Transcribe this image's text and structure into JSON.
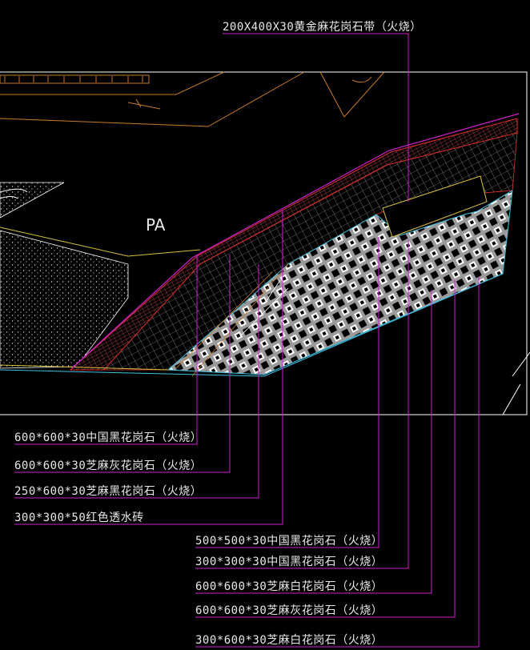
{
  "zone_label": "PA",
  "top_callout": "200X400X30黄金麻花岗石带（火烧）",
  "left_callouts": [
    "600*600*30中国黑花岗石（火烧）",
    "600*600*30芝麻灰花岗石（火烧）",
    "250*600*30芝麻黑花岗石（火烧）",
    "300*300*50红色透水砖"
  ],
  "right_callouts": [
    "500*500*30中国黑花岗石（火烧）",
    "300*300*30中国黑花岗石（火烧）",
    "600*600*30芝麻白花岗石（火烧）",
    "600*600*30芝麻灰花岗石（火烧）",
    "300*600*30芝麻白花岗石（火烧）"
  ],
  "colors": {
    "background": "#000000",
    "leader": "#d020d0",
    "outline": "#ffffff",
    "red_line": "#e03030",
    "orange": "#c87a2a",
    "yellow": "#d8c040",
    "cyan": "#40c0e0",
    "tile_gray": "#9a9a9a"
  }
}
